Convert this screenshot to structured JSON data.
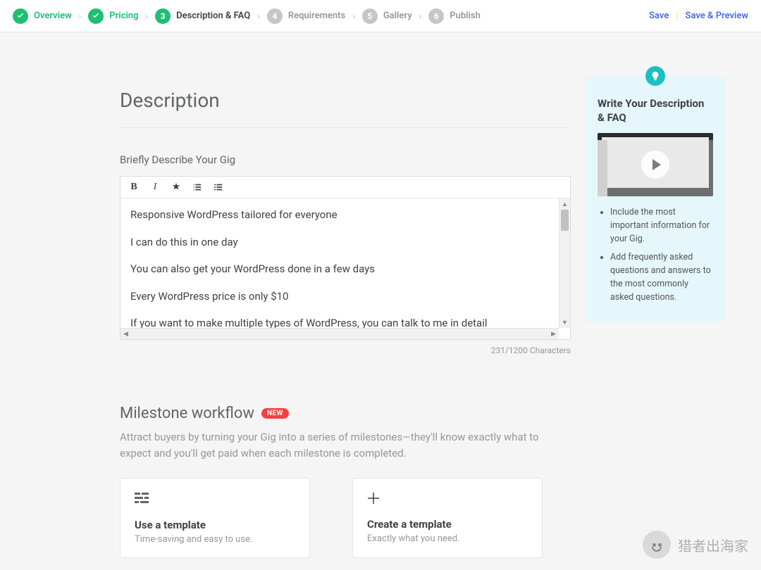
{
  "steps": [
    {
      "label": "Overview",
      "state": "done"
    },
    {
      "label": "Pricing",
      "state": "done"
    },
    {
      "num": "3",
      "label": "Description & FAQ",
      "state": "active"
    },
    {
      "num": "4",
      "label": "Requirements",
      "state": "pending"
    },
    {
      "num": "5",
      "label": "Gallery",
      "state": "pending"
    },
    {
      "num": "6",
      "label": "Publish",
      "state": "pending"
    }
  ],
  "top_actions": {
    "save": "Save",
    "save_preview": "Save & Preview"
  },
  "section": {
    "title": "Description",
    "field_label": "Briefly Describe Your Gig",
    "lines": [
      "Responsive WordPress tailored for everyone",
      "I can do this in one day",
      "You can also get your WordPress done in a few days",
      "Every WordPress price is only $10",
      "If you want to make multiple types of WordPress, you can talk to me in detail"
    ],
    "counter": "231/1200 Characters"
  },
  "milestone": {
    "title": "Milestone workflow",
    "badge": "NEW",
    "desc": "Attract buyers by turning your Gig into a series of milestones—they'll know exactly what to expect and you'll get paid when each milestone is completed.",
    "cards": [
      {
        "title": "Use a template",
        "sub": "Time-saving and easy to use."
      },
      {
        "title": "Create a template",
        "sub": "Exactly what you need."
      }
    ]
  },
  "help": {
    "title": "Write Your Description & FAQ",
    "tips": [
      "Include the most important information for your Gig.",
      "Add frequently asked questions and answers to the most commonly asked questions."
    ]
  },
  "watermark": "猎者出海家"
}
